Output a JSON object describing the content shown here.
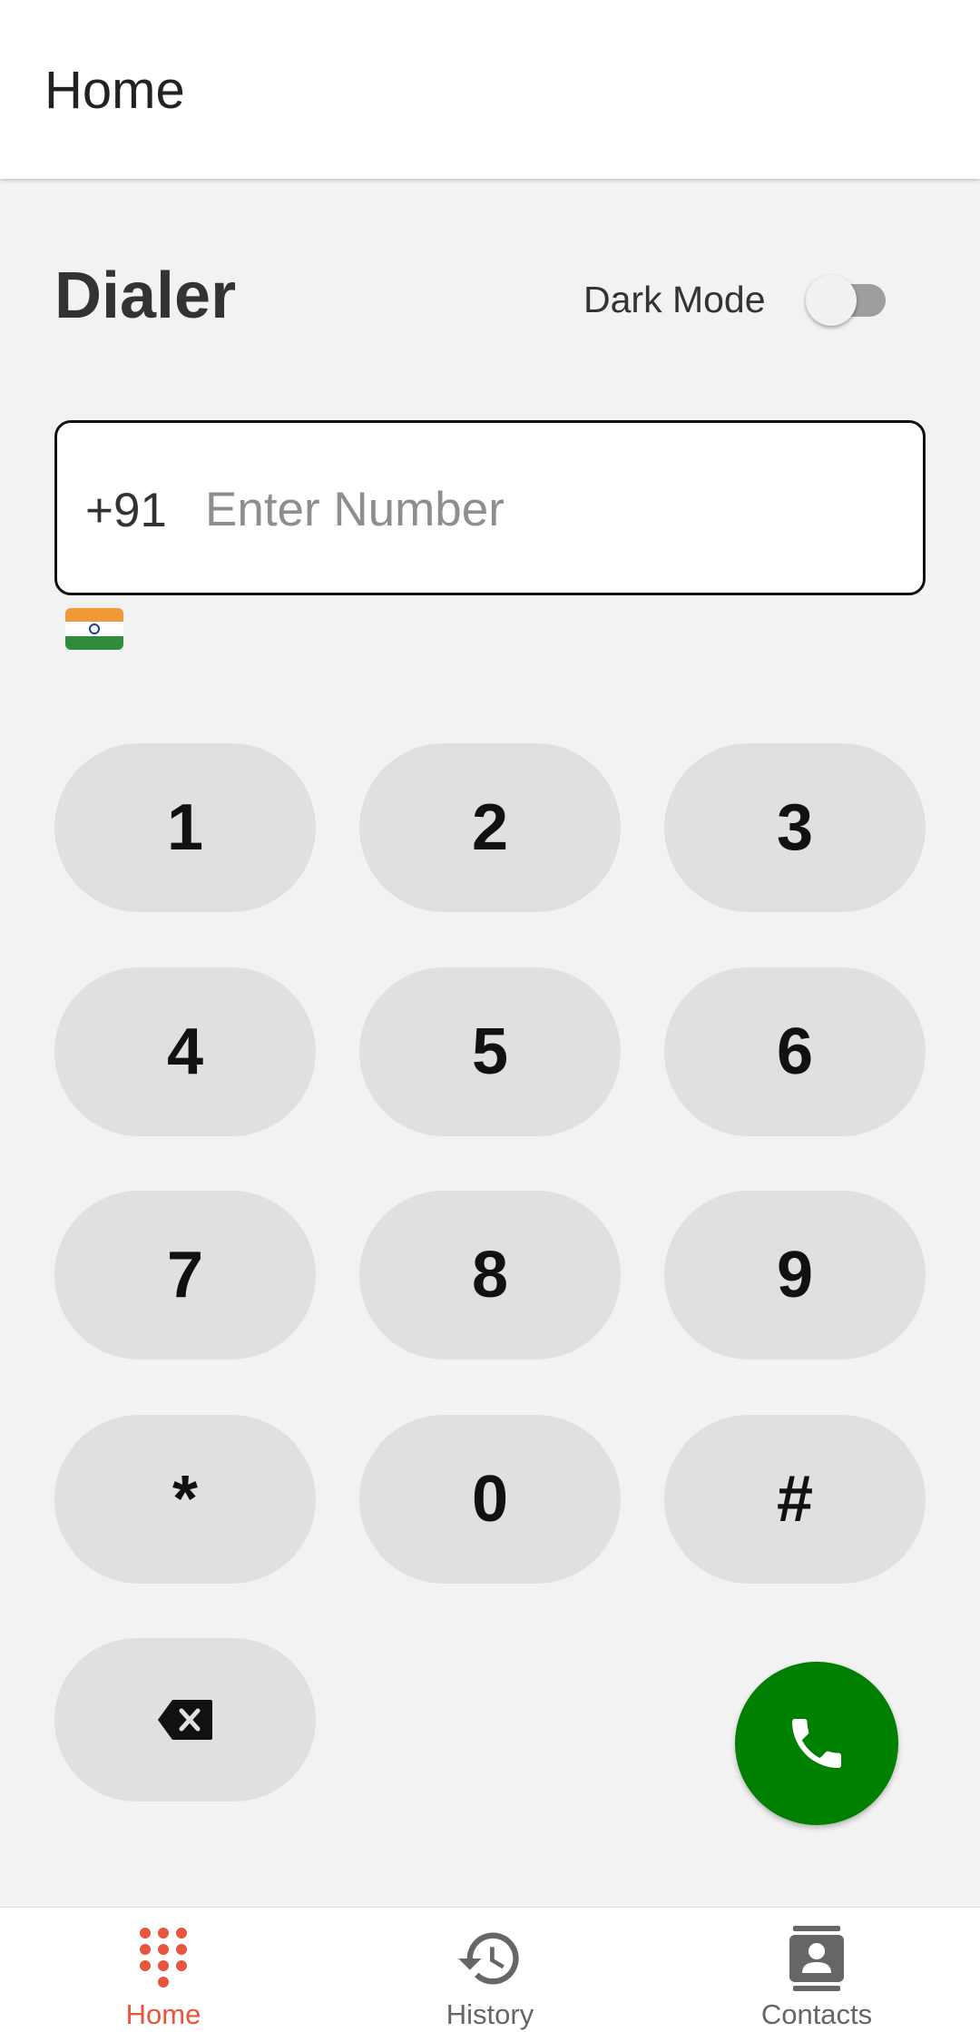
{
  "app_bar": {
    "title": "Home"
  },
  "dialer": {
    "title": "Dialer",
    "dark_mode_label": "Dark Mode",
    "dark_mode_on": false
  },
  "number_field": {
    "country_code": "+91",
    "value": "",
    "placeholder": "Enter Number",
    "country_flag": "india-flag-icon"
  },
  "keypad": {
    "keys": [
      "1",
      "2",
      "3",
      "4",
      "5",
      "6",
      "7",
      "8",
      "9",
      "*",
      "0",
      "#"
    ],
    "backspace_icon": "backspace-icon",
    "call_icon": "phone-icon"
  },
  "bottom_nav": {
    "items": [
      {
        "label": "Home",
        "icon": "dialpad-icon",
        "active": true
      },
      {
        "label": "History",
        "icon": "history-icon",
        "active": false
      },
      {
        "label": "Contacts",
        "icon": "contact-card-icon",
        "active": false
      }
    ]
  },
  "colors": {
    "background": "#f2f2f2",
    "key_background": "#e0e0e0",
    "call_button": "#008000",
    "nav_active": "#e8553d",
    "nav_inactive": "#666666"
  }
}
